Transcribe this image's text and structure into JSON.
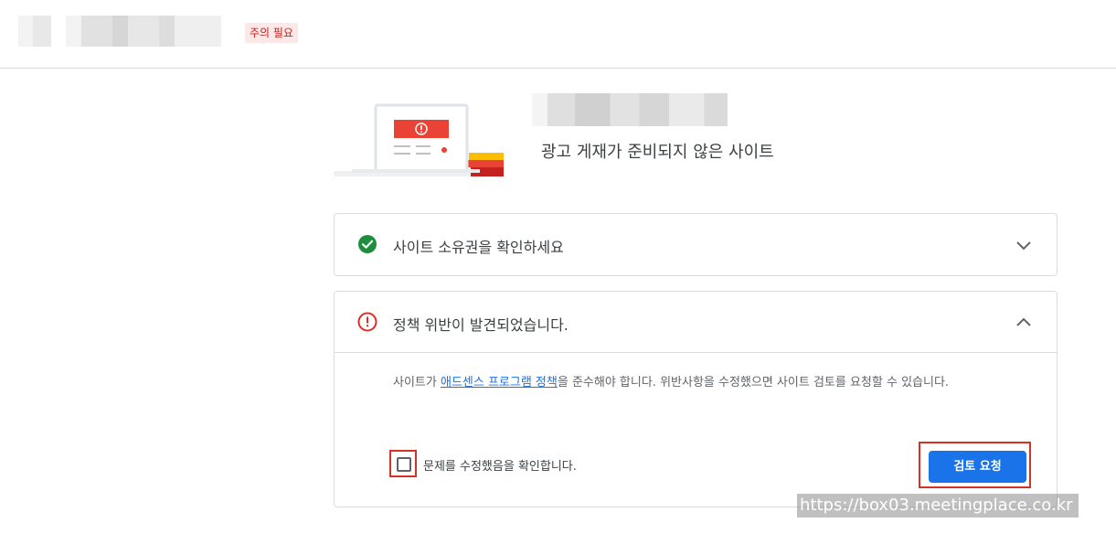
{
  "header": {
    "status_badge": "주의 필요"
  },
  "site": {
    "subtitle": "광고 게재가 준비되지 않은 사이트"
  },
  "cards": {
    "ownership": {
      "title": "사이트 소유권을 확인하세요",
      "status": "success"
    },
    "policy": {
      "title": "정책 위반이 발견되었습니다.",
      "status": "error",
      "desc_before": "사이트가 ",
      "desc_link": "애드센스 프로그램 정책",
      "desc_after": "을 준수해야 합니다. 위반사항을 수정했으면 사이트 검토를 요청할 수 있습니다.",
      "checkbox_label": "문제를 수정했음을 확인합니다.",
      "checkbox_checked": false,
      "button_label": "검토 요청"
    }
  },
  "watermark": "https://box03.meetingplace.co.kr",
  "colors": {
    "accent": "#1a73e8",
    "error": "#d93025",
    "success": "#1e8e3e",
    "badge_bg": "#fce8e6"
  },
  "icons": {
    "ownership_status": "check-circle-icon",
    "policy_status": "error-circle-icon",
    "expand": "chevron-down-icon",
    "collapse": "chevron-up-icon"
  }
}
